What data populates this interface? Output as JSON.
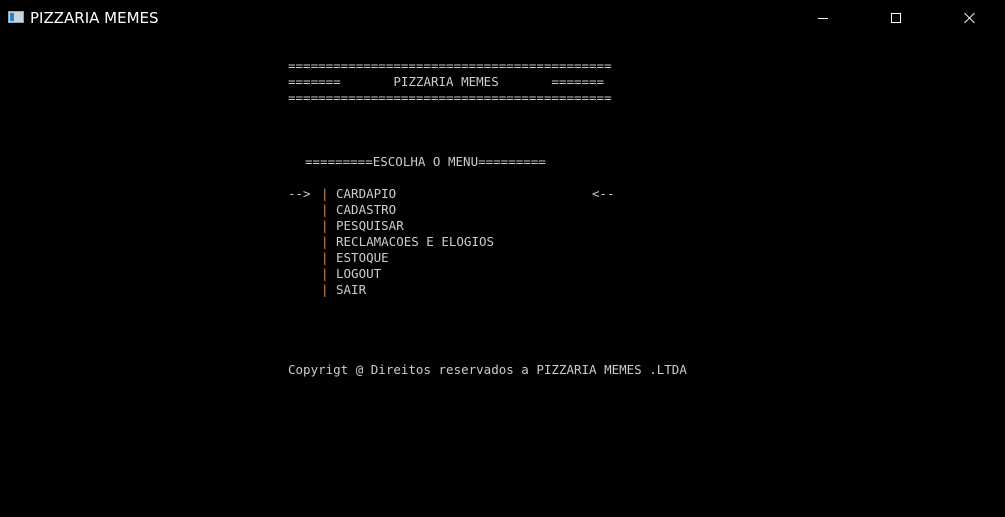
{
  "window": {
    "title": "PIZZARIA MEMES"
  },
  "console": {
    "header_line_1": "===========================================",
    "header_line_2": "=======       PIZZARIA MEMES       =======",
    "header_line_3": "===========================================",
    "menu_heading": "=========ESCOLHA O MENU=========",
    "selector_left": "-->",
    "selector_right": "<--",
    "separator": "|",
    "menu_items": [
      {
        "label": "CARDAPIO"
      },
      {
        "label": "CADASTRO"
      },
      {
        "label": "PESQUISAR"
      },
      {
        "label": "RECLAMACOES E ELOGIOS"
      },
      {
        "label": "ESTOQUE"
      },
      {
        "label": "LOGOUT"
      },
      {
        "label": "SAIR"
      }
    ],
    "copyright": "Copyrigt @ Direitos reservados a PIZZARIA MEMES .LTDA"
  },
  "colors": {
    "background": "#000000",
    "text": "#cccccc",
    "separator": "#d28a4a"
  }
}
